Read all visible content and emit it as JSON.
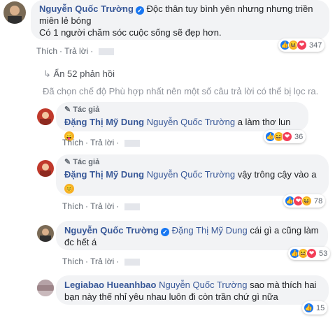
{
  "comment1": {
    "author": "Nguyễn Quốc Trường",
    "text_line1": "Độc thân tuy bình yên nhưng nhưng triền",
    "text_line2": "miên lẻ bóng",
    "text_line3": "Có 1 người chăm sóc cuộc sống sẽ đẹp hơn.",
    "like_label": "Thích",
    "reply_label": "Trả lời",
    "reaction_count": "347"
  },
  "hidden_replies": "Ẩn 52 phản hồi",
  "filter_notice": "Đã chọn chế độ Phù hợp nhất nên một số câu trả lời có thể bị lọc ra.",
  "reply1": {
    "badge": "Tác giả",
    "author": "Đặng Thị Mỹ Dung",
    "tagged": "Nguyễn Quốc Trường",
    "text": "a làm thơ lun",
    "like_label": "Thích",
    "reply_label": "Trả lời",
    "reaction_count": "36"
  },
  "reply2": {
    "badge": "Tác giả",
    "author": "Đặng Thị Mỹ Dung",
    "tagged": "Nguyễn Quốc Trường",
    "text": "vậy trông cậy vào a",
    "like_label": "Thích",
    "reply_label": "Trả lời",
    "reaction_count": "78"
  },
  "reply3": {
    "author": "Nguyễn Quốc Trường",
    "tagged": "Đặng Thị Mỹ Dung",
    "text_line1": "cái gì a cũng làm",
    "text_line2": "đc hết á",
    "like_label": "Thích",
    "reply_label": "Trả lời",
    "reaction_count": "53"
  },
  "reply4": {
    "author": "Legiabao Hueanhbao",
    "tagged": "Nguyễn Quốc Trường",
    "text_line1": "sao mà thích hai",
    "text_line2": "bạn này thế nhỉ yêu nhau luôn đi còn trần chứ gì nữa",
    "reaction_count": "15"
  },
  "icons": {
    "verified": "verified-check-icon",
    "pencil": "author-pencil-icon",
    "reply_arrow": "reply-arrow-icon",
    "like": "like-icon",
    "haha": "haha-icon",
    "love": "love-icon"
  },
  "colors": {
    "link": "#385898",
    "bubble": "#f2f3f5",
    "like": "#1877f2",
    "haha": "#f7b125",
    "love": "#f33e58"
  }
}
